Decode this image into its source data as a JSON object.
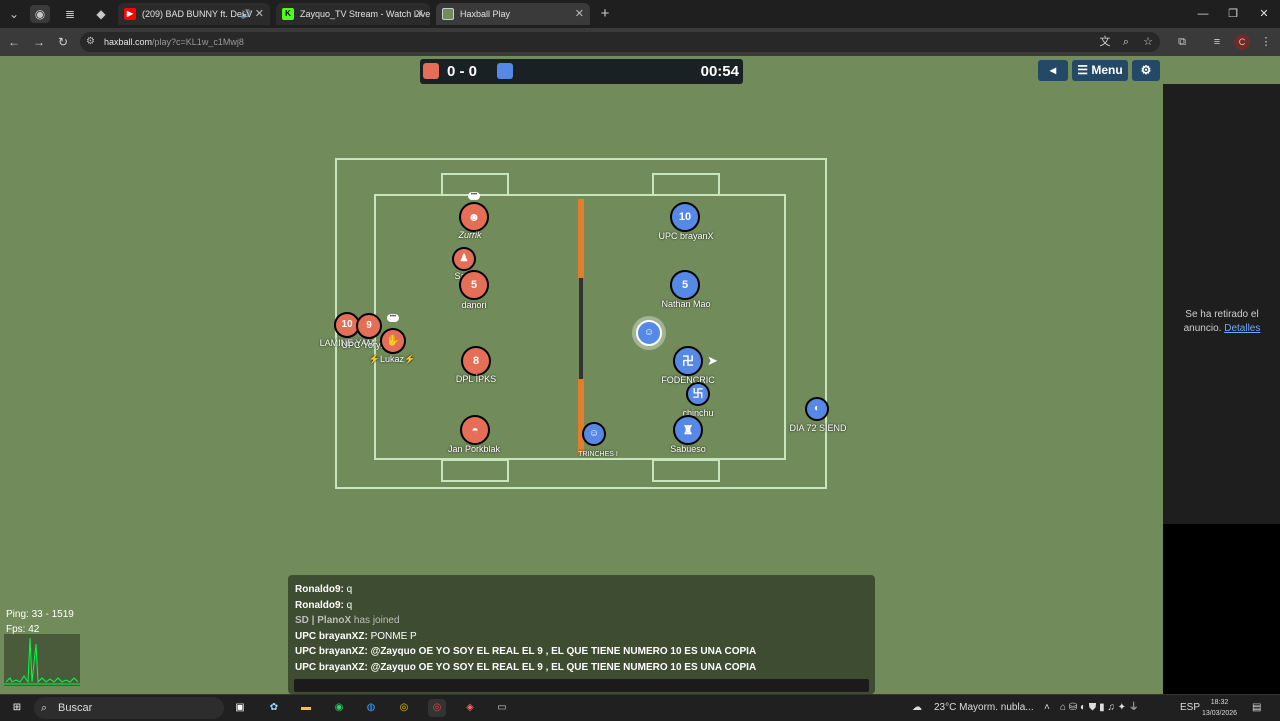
{
  "browser": {
    "tabs": [
      {
        "label": "(209) BAD BUNNY ft. Dei V",
        "favicon": "youtube-icon",
        "muted_icon": "speaker-icon"
      },
      {
        "label": "Zayquo_TV Stream - Watch Live",
        "favicon": "kick-icon"
      },
      {
        "label": "Haxball Play",
        "favicon": "haxball-icon"
      }
    ],
    "url_site": "haxball.com",
    "url_rest": "/play?c=KL1w_c1Mwj8"
  },
  "game": {
    "score": "0 - 0",
    "timer": "00:54",
    "team_colors": {
      "red": "#e56e56",
      "blue": "#5689e5"
    },
    "menu_label": "Menu",
    "red_players": [
      {
        "number": "",
        "name": "Zurrik"
      },
      {
        "number": "",
        "name": "Sa"
      },
      {
        "number": "5",
        "name": "danori"
      },
      {
        "number": "10",
        "name": "LAMINE YAM"
      },
      {
        "number": "9",
        "name": "UPC Yoryi"
      },
      {
        "number": "",
        "name": "⚡Lukaz⚡"
      },
      {
        "number": "8",
        "name": "DPL ÌPKS"
      },
      {
        "number": "",
        "name": "Jan Porkblak"
      }
    ],
    "blue_players": [
      {
        "number": "10",
        "name": "UPC brayanX"
      },
      {
        "number": "5",
        "name": "Nathan Mao"
      },
      {
        "number": "卍",
        "name": "FODENCRIC"
      },
      {
        "number": "卐",
        "name": "chinchu"
      },
      {
        "number": "",
        "name": "Sabueso"
      },
      {
        "number": "",
        "name": "DIA 72 SIEND"
      },
      {
        "number": "",
        "name": "TRINCHES I"
      }
    ]
  },
  "chat": {
    "lines": [
      {
        "author": "Ronaldo9:",
        "text": " q",
        "type": "msg"
      },
      {
        "author": "Ronaldo9:",
        "text": " q",
        "type": "msg"
      },
      {
        "author": "SD | PlanoX",
        "text": " has joined",
        "type": "join"
      },
      {
        "author": "UPC brayanXZ:",
        "text": " PONME P",
        "type": "msg"
      },
      {
        "author": "UPC brayanXZ: @Zayquo",
        "text": " OE YO SOY EL REAL EL 9 , EL QUE TIENE NUMERO 10 ES UNA COPIA",
        "type": "bold"
      },
      {
        "author": "UPC brayanXZ: @Zayquo",
        "text": " OE YO SOY EL REAL EL 9 , EL QUE TIENE NUMERO 10 ES UNA COPIA",
        "type": "bold"
      }
    ]
  },
  "stats": {
    "ping": "Ping: 33 - 1519",
    "fps": "Fps: 42"
  },
  "ad": {
    "text": "Se ha retirado el anuncio.",
    "link": "Detalles"
  },
  "taskbar": {
    "search": "Buscar",
    "weather": "23°C  Mayorm. nubla...",
    "lang": "ESP",
    "time": "18:32",
    "date": "13/03/2026"
  }
}
